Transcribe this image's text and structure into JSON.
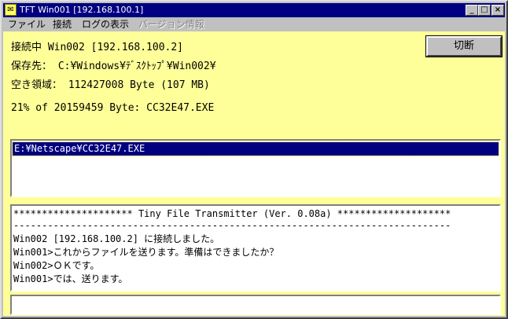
{
  "window": {
    "title": "TFT  Win001 [192.168.100.1]",
    "minimize_icon": "minimize-icon",
    "maximize_icon": "maximize-icon",
    "close_icon": "close-icon"
  },
  "menu": {
    "items": [
      "ファイル",
      "接続",
      "ログの表示",
      "バージョン情報"
    ],
    "disabled_index": 3
  },
  "status": {
    "connection": "接続中 Win002 [192.168.100.2]",
    "save_to": "保存先： C:¥Windows¥ﾃﾞｽｸﾄｯﾌﾟ¥Win002¥",
    "free_space": "空き領域：  112427008 Byte (107 MB)",
    "progress": " 21% of 20159459 Byte: CC32E47.EXE",
    "progress_percent": 21
  },
  "buttons": {
    "disconnect": "切断"
  },
  "file_list": {
    "items": [
      "E:¥Netscape¥CC32E47.EXE"
    ],
    "selected_index": 0
  },
  "log": {
    "lines": [
      "********************* Tiny File Transmitter (Ver. 0.08a) ********************",
      "-----------------------------------------------------------------------------",
      "Win002 [192.168.100.2] に接続しました。",
      "Win001>これからファイルを送ります。準備はできましたか？",
      "Win002>ＯＫです。",
      "Win001>では、送ります。"
    ]
  },
  "message_input": {
    "value": ""
  },
  "colors": {
    "client_bg": "#ffff99",
    "titlebar": "#000080",
    "selection": "#000080"
  }
}
